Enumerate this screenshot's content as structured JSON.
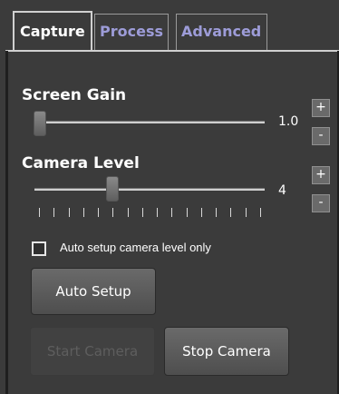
{
  "tabs": [
    {
      "label": "Capture",
      "active": true
    },
    {
      "label": "Process",
      "active": false
    },
    {
      "label": "Advanced",
      "active": false
    }
  ],
  "screen_gain": {
    "label": "Screen Gain",
    "value": "1.0",
    "increment_label": "+",
    "decrement_label": "-",
    "slider_fraction": 0.0
  },
  "camera_level": {
    "label": "Camera Level",
    "value": "4",
    "increment_label": "+",
    "decrement_label": "-",
    "slider_fraction": 0.23
  },
  "auto_setup": {
    "checkbox_label": "Auto setup camera level only",
    "checked": false,
    "button_label": "Auto Setup"
  },
  "camera_buttons": {
    "start_label": "Start Camera",
    "start_enabled": false,
    "stop_label": "Stop Camera",
    "stop_enabled": true
  },
  "colors": {
    "background": "#3b3b3b",
    "active_tab_text": "#ffffff",
    "inactive_tab_text": "#9d9cd8"
  }
}
